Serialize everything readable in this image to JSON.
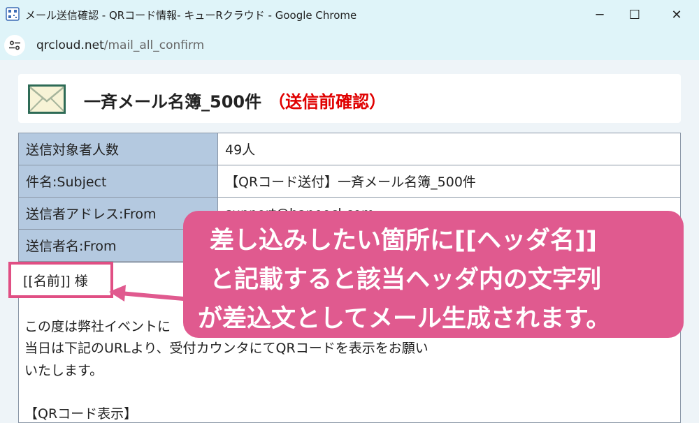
{
  "window": {
    "title": "メール送信確認 - QRコード情報- キューRクラウド - Google Chrome",
    "app_icon": "qr-app-icon",
    "controls": {
      "minimize": "─",
      "maximize": "☐",
      "close": "✕"
    }
  },
  "address_bar": {
    "host": "qrcloud.net",
    "path": "/mail_all_confirm",
    "site_info_icon": "tune-icon"
  },
  "header": {
    "icon": "mail-envelope-icon",
    "title": "一斉メール名簿_500件",
    "status": "（送信前確認）"
  },
  "table": {
    "rows": [
      {
        "label": "送信対象者人数",
        "value": "49人"
      },
      {
        "label": "件名:Subject",
        "value": "【QRコード送付】一斉メール名簿_500件"
      },
      {
        "label": "送信者アドレス:From",
        "value": "support@haneocl.com"
      },
      {
        "label": "送信者名:From",
        "value": ""
      }
    ]
  },
  "body": {
    "salutation": "[[名前]] 様",
    "lines": [
      "この度は弊社イベントに",
      "当日は下記のURLより、受付カウンタにてQRコードを表示をお願い",
      "いたします。",
      "",
      "【QRコード表示】"
    ]
  },
  "callout": {
    "lines": [
      "差し込みしたい箇所に[[ヘッダ名]]",
      "と記載すると該当ヘッダ内の文字列",
      "が差込文としてメール生成されます。"
    ],
    "color": "#e05a8f"
  }
}
